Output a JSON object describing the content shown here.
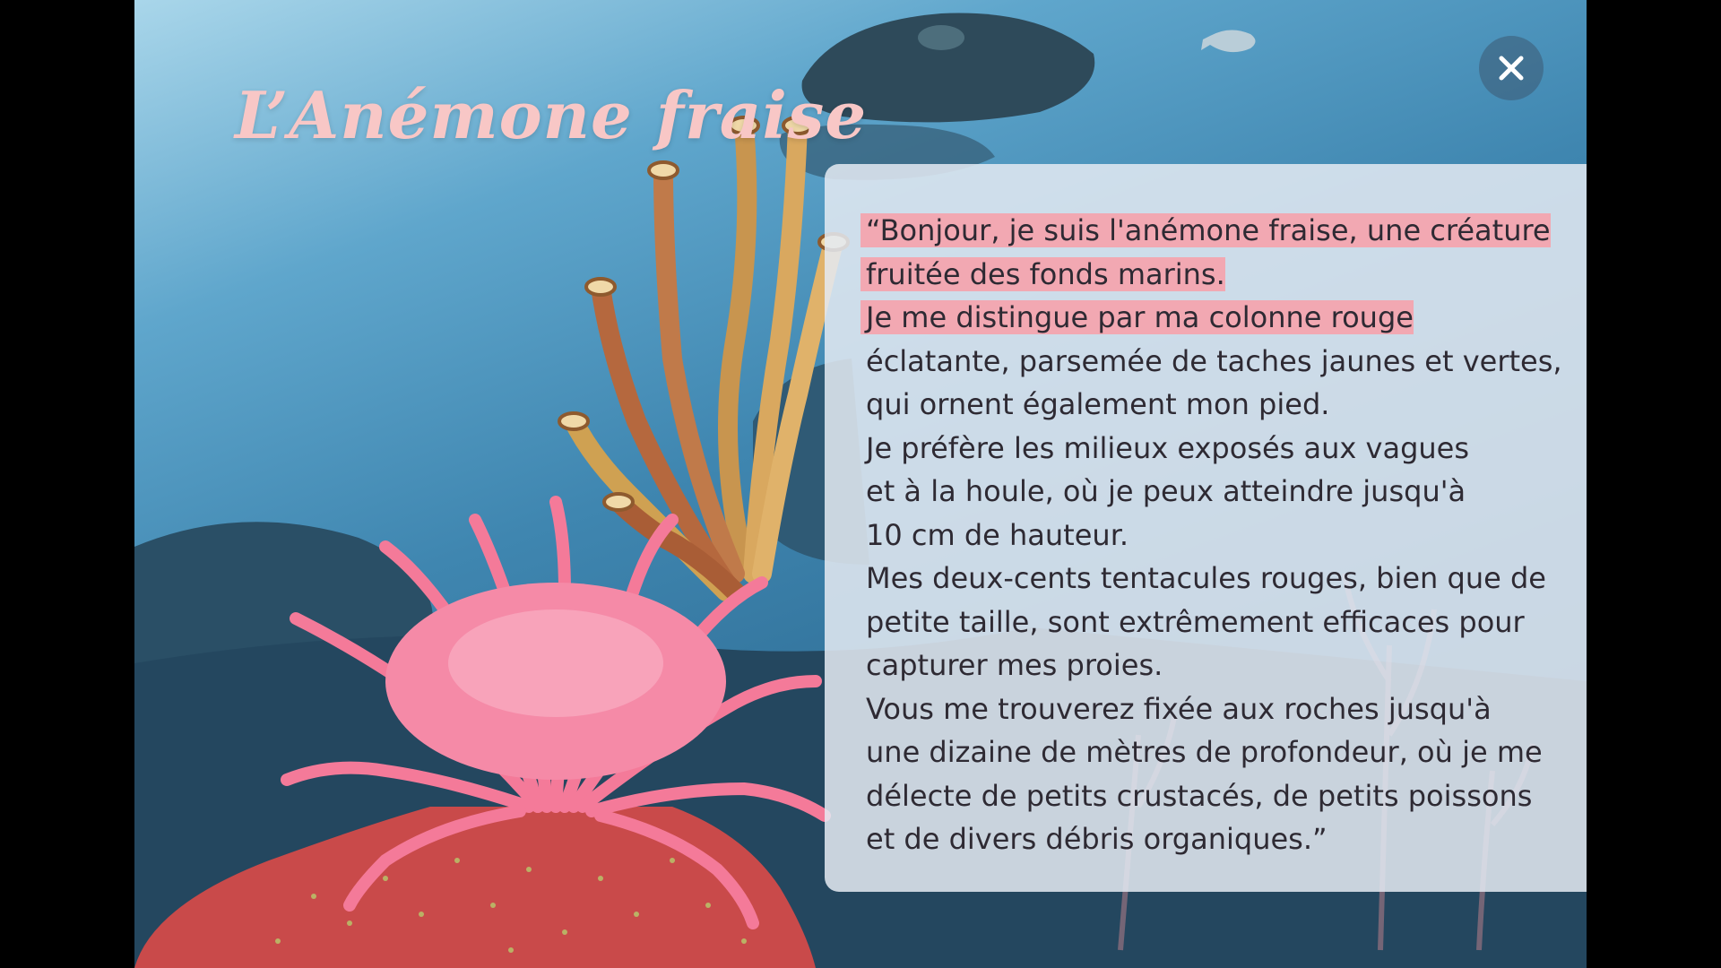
{
  "title": "L’Anémone fraise",
  "close_label": "×",
  "colors": {
    "title": "#f8c7c6",
    "highlight": "#f2a8b2",
    "anemone_body": "#c94a4a",
    "tentacles": "#f47a99",
    "panel": "#e4eaf2"
  },
  "text_lines": [
    {
      "text": "“Bonjour, je suis l'anémone fraise, une créature",
      "highlighted": true
    },
    {
      "text": "fruitée des fonds marins.",
      "highlighted": true
    },
    {
      "text": "Je me distingue par ma colonne rouge",
      "highlighted": true
    },
    {
      "text": "éclatante, parsemée de taches jaunes et vertes,",
      "highlighted": false
    },
    {
      "text": "qui ornent également mon pied.",
      "highlighted": false
    },
    {
      "text": "Je préfère les milieux exposés aux vagues",
      "highlighted": false
    },
    {
      "text": "et à la houle, où je peux atteindre jusqu'à",
      "highlighted": false
    },
    {
      "text": "10 cm de hauteur.",
      "highlighted": false
    },
    {
      "text": "Mes deux-cents tentacules rouges, bien que de",
      "highlighted": false
    },
    {
      "text": "petite taille, sont extrêmement efficaces pour",
      "highlighted": false
    },
    {
      "text": "capturer mes proies.",
      "highlighted": false
    },
    {
      "text": "Vous me trouverez fixée aux roches jusqu'à",
      "highlighted": false
    },
    {
      "text": "une dizaine de mètres de profondeur, où je me",
      "highlighted": false
    },
    {
      "text": "délecte de petits crustacés, de petits poissons",
      "highlighted": false
    },
    {
      "text": "et de divers débris organiques.”",
      "highlighted": false
    }
  ]
}
